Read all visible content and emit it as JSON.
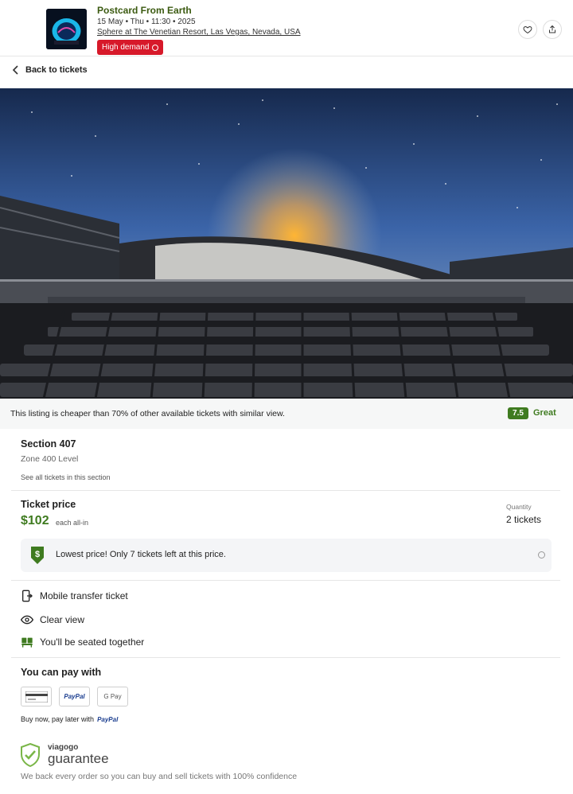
{
  "header": {
    "event_title": "Postcard From Earth",
    "event_date": "15 May • Thu • 11:30 • 2025",
    "venue": "Sphere at The Venetian Resort, Las Vegas, Nevada, USA",
    "badge": "High demand"
  },
  "nav": {
    "back_label": "Back to tickets"
  },
  "banner": {
    "text": "This listing is cheaper than 70% of other available tickets with similar view.",
    "score": "7.5",
    "score_label": "Great"
  },
  "section": {
    "title": "Section 407",
    "zone": "Zone 400 Level",
    "see_all": "See all tickets in this section"
  },
  "pricing": {
    "title": "Ticket price",
    "price": "$102",
    "price_note": "each all-in",
    "quantity_label": "Quantity",
    "quantity_value": "2 tickets",
    "alert_text": "Lowest price! Only 7 tickets left at this price."
  },
  "features": [
    {
      "icon": "mobile-transfer-icon",
      "label": "Mobile transfer ticket"
    },
    {
      "icon": "eye-icon",
      "label": "Clear view"
    },
    {
      "icon": "seats-icon",
      "label": "You'll be seated together"
    }
  ],
  "payment": {
    "title": "You can pay with",
    "methods": [
      "card",
      "PayPal",
      "G Pay"
    ],
    "bnpl_text": "Buy now, pay later with",
    "bnpl_brand": "PayPal"
  },
  "guarantee": {
    "brand": "viagogo",
    "word": "guarantee",
    "text": "We back every order so you can buy and sell tickets with 100% confidence"
  },
  "colors": {
    "accent_green": "#3f7b20",
    "badge_red": "#d7192a",
    "title_green": "#3b5a10"
  }
}
